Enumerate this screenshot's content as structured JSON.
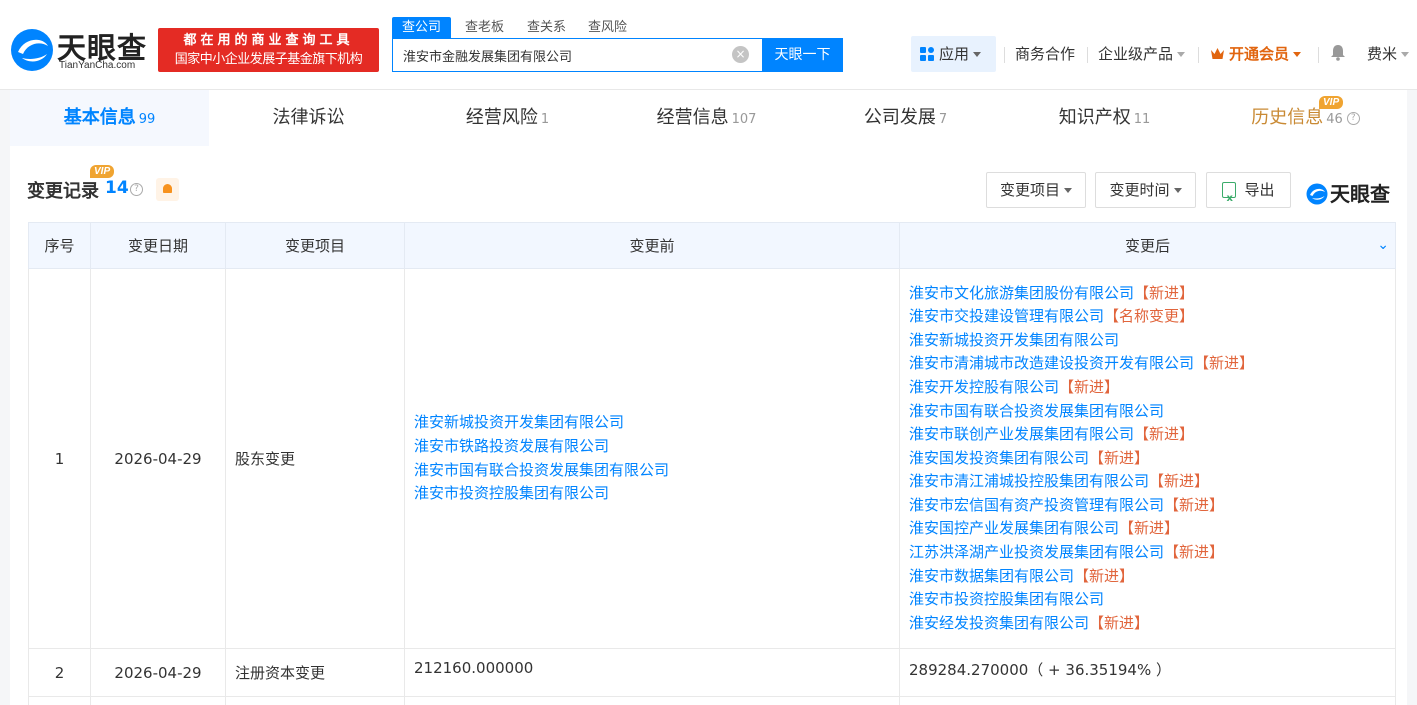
{
  "header": {
    "logo_text": "天眼查",
    "logo_sub": "TianYanCha.com",
    "promo_line1": "都在用的商业查询工具",
    "promo_line2": "国家中小企业发展子基金旗下机构",
    "search_tabs": [
      "查公司",
      "查老板",
      "查关系",
      "查风险"
    ],
    "search_value": "淮安市金融发展集团有限公司",
    "search_button": "天眼一下",
    "nav": {
      "app": "应用",
      "business": "商务合作",
      "enterprise": "企业级产品",
      "vip": "开通会员",
      "user": "费米"
    }
  },
  "module_tabs": [
    {
      "label": "基本信息",
      "count": "99"
    },
    {
      "label": "法律诉讼",
      "count": ""
    },
    {
      "label": "经营风险",
      "count": "1"
    },
    {
      "label": "经营信息",
      "count": "107"
    },
    {
      "label": "公司发展",
      "count": "7"
    },
    {
      "label": "知识产权",
      "count": "11"
    },
    {
      "label": "历史信息",
      "count": "46"
    }
  ],
  "vip_badge": "VIP",
  "section": {
    "title": "变更记录",
    "count": "14",
    "filter_item": "变更项目",
    "filter_time": "变更时间",
    "export": "导出",
    "brand": "天眼查"
  },
  "table": {
    "headers": [
      "序号",
      "变更日期",
      "变更项目",
      "变更前",
      "变更后"
    ],
    "rows": [
      {
        "no": "1",
        "date": "2026-04-29",
        "item": "股东变更",
        "before": [
          "淮安新城投资开发集团有限公司",
          "淮安市铁路投资发展有限公司",
          "淮安市国有联合投资发展集团有限公司",
          "淮安市投资控股集团有限公司"
        ],
        "after": [
          {
            "name": "淮安市文化旅游集团股份有限公司",
            "tag": "【新进】"
          },
          {
            "name": "淮安市交投建设管理有限公司",
            "tag": "【名称变更】"
          },
          {
            "name": "淮安新城投资开发集团有限公司",
            "tag": ""
          },
          {
            "name": "淮安市清浦城市改造建设投资开发有限公司",
            "tag": "【新进】"
          },
          {
            "name": "淮安开发控股有限公司",
            "tag": "【新进】"
          },
          {
            "name": "淮安市国有联合投资发展集团有限公司",
            "tag": ""
          },
          {
            "name": "淮安市联创产业发展集团有限公司",
            "tag": "【新进】"
          },
          {
            "name": "淮安国发投资集团有限公司",
            "tag": "【新进】"
          },
          {
            "name": "淮安市清江浦城投控股集团有限公司",
            "tag": "【新进】"
          },
          {
            "name": "淮安市宏信国有资产投资管理有限公司",
            "tag": "【新进】"
          },
          {
            "name": "淮安国控产业发展集团有限公司",
            "tag": "【新进】"
          },
          {
            "name": "江苏洪泽湖产业投资发展集团有限公司",
            "tag": "【新进】"
          },
          {
            "name": "淮安市数据集团有限公司",
            "tag": "【新进】"
          },
          {
            "name": "淮安市投资控股集团有限公司",
            "tag": ""
          },
          {
            "name": "淮安经发投资集团有限公司",
            "tag": "【新进】"
          }
        ]
      },
      {
        "no": "2",
        "date": "2026-04-29",
        "item": "注册资本变更",
        "before_text": "212160.000000",
        "after_text": "289284.270000（ + 36.35194% ）"
      }
    ]
  }
}
